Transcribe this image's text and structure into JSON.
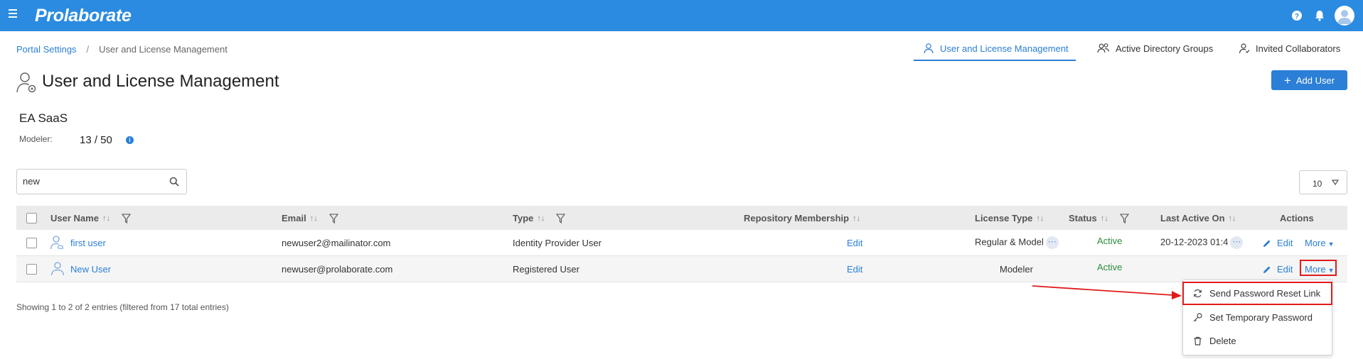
{
  "app": {
    "logo": "Prolaborate"
  },
  "topbar_icons": [
    "hamburger-menu-icon",
    "help-icon",
    "bell-icon",
    "user-avatar-icon"
  ],
  "breadcrumb": {
    "parent": "Portal Settings",
    "separator": "/",
    "current": "User and License Management"
  },
  "tabs": [
    {
      "label": "User and License Management",
      "icon": "user-icon",
      "active": true
    },
    {
      "label": "Active Directory Groups",
      "icon": "group-icon",
      "active": false
    },
    {
      "label": "Invited Collaborators",
      "icon": "invited-user-icon",
      "active": false
    }
  ],
  "page": {
    "title": "User and License Management",
    "add_user_label": "Add User"
  },
  "license": {
    "org_name": "EA SaaS",
    "modeler_label": "Modeler:",
    "modeler_count": "13 / 50"
  },
  "search": {
    "value": "new"
  },
  "page_size": "10",
  "table": {
    "columns": [
      {
        "label": "User Name",
        "sortable": true,
        "filter": true
      },
      {
        "label": "Email",
        "sortable": true,
        "filter": true
      },
      {
        "label": "Type",
        "sortable": true,
        "filter": true
      },
      {
        "label": "Repository Membership",
        "sortable": true,
        "filter": false
      },
      {
        "label": "License Type",
        "sortable": true,
        "filter": false
      },
      {
        "label": "Status",
        "sortable": true,
        "filter": true
      },
      {
        "label": "Last Active On",
        "sortable": true,
        "filter": false
      },
      {
        "label": "Actions",
        "sortable": false,
        "filter": false
      }
    ],
    "sort_glyph": "↑↓",
    "rows": [
      {
        "user_name": "first user",
        "email": "newuser2@mailinator.com",
        "type": "Identity Provider User",
        "repository_membership": "Edit",
        "license_type": "Regular & Model",
        "status": "Active",
        "last_active_on": "20-12-2023 01:4",
        "edit_label": "Edit",
        "more_label": "More"
      },
      {
        "user_name": "New User",
        "email": "newuser@prolaborate.com",
        "type": "Registered User",
        "repository_membership": "Edit",
        "license_type": "Modeler",
        "status": "Active",
        "last_active_on": "",
        "edit_label": "Edit",
        "more_label": "More"
      }
    ]
  },
  "footer": {
    "showing_text": "Showing 1 to 2 of 2 entries (filtered from 17 total entries)"
  },
  "more_menu": {
    "items": [
      {
        "label": "Send Password Reset Link",
        "icon": "refresh-icon"
      },
      {
        "label": "Set Temporary Password",
        "icon": "key-icon"
      },
      {
        "label": "Delete",
        "icon": "trash-icon"
      }
    ]
  },
  "colors": {
    "topbar": "#2b8be0",
    "accent": "#2b7fd6",
    "status_active": "#2e8b3d",
    "annotation_red": "#e01b1b"
  }
}
